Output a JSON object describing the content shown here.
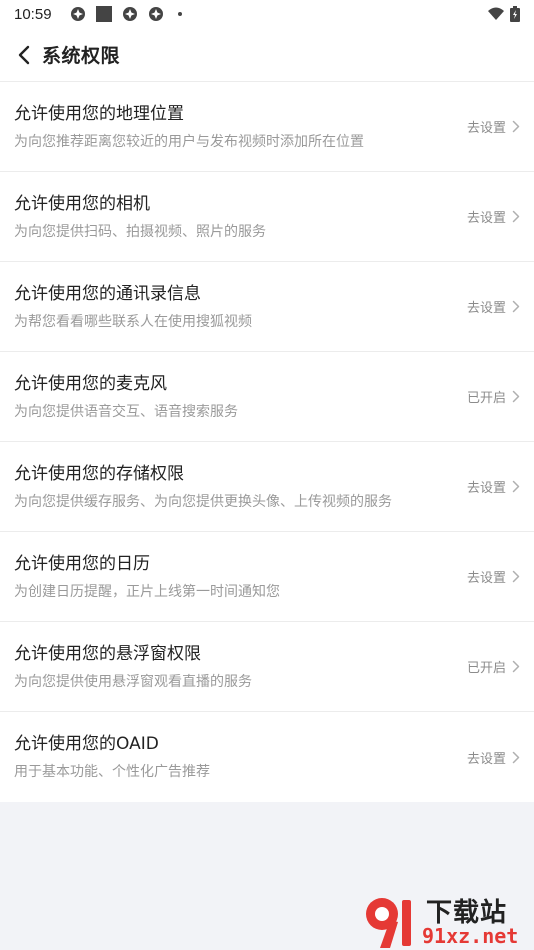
{
  "status_bar": {
    "time": "10:59"
  },
  "header": {
    "title": "系统权限"
  },
  "permissions": [
    {
      "title": "允许使用您的地理位置",
      "desc": "为向您推荐距离您较近的用户与发布视频时添加所在位置",
      "action": "去设置"
    },
    {
      "title": "允许使用您的相机",
      "desc": "为向您提供扫码、拍摄视频、照片的服务",
      "action": "去设置"
    },
    {
      "title": "允许使用您的通讯录信息",
      "desc": "为帮您看看哪些联系人在使用搜狐视频",
      "action": "去设置"
    },
    {
      "title": "允许使用您的麦克风",
      "desc": "为向您提供语音交互、语音搜索服务",
      "action": "已开启"
    },
    {
      "title": "允许使用您的存储权限",
      "desc": "为向您提供缓存服务、为向您提供更换头像、上传视频的服务",
      "action": "去设置"
    },
    {
      "title": "允许使用您的日历",
      "desc": "为创建日历提醒，正片上线第一时间通知您",
      "action": "去设置"
    },
    {
      "title": "允许使用您的悬浮窗权限",
      "desc": "为向您提供使用悬浮窗观看直播的服务",
      "action": "已开启"
    },
    {
      "title": "允许使用您的OAID",
      "desc": "用于基本功能、个性化广告推荐",
      "action": "去设置"
    }
  ],
  "watermark": {
    "top": "下载站",
    "bottom": "91xz.net"
  },
  "colors": {
    "background": "#f2f3f7",
    "card": "#ffffff",
    "muted": "#9a9a9a",
    "watermark_red": "#e53935"
  }
}
